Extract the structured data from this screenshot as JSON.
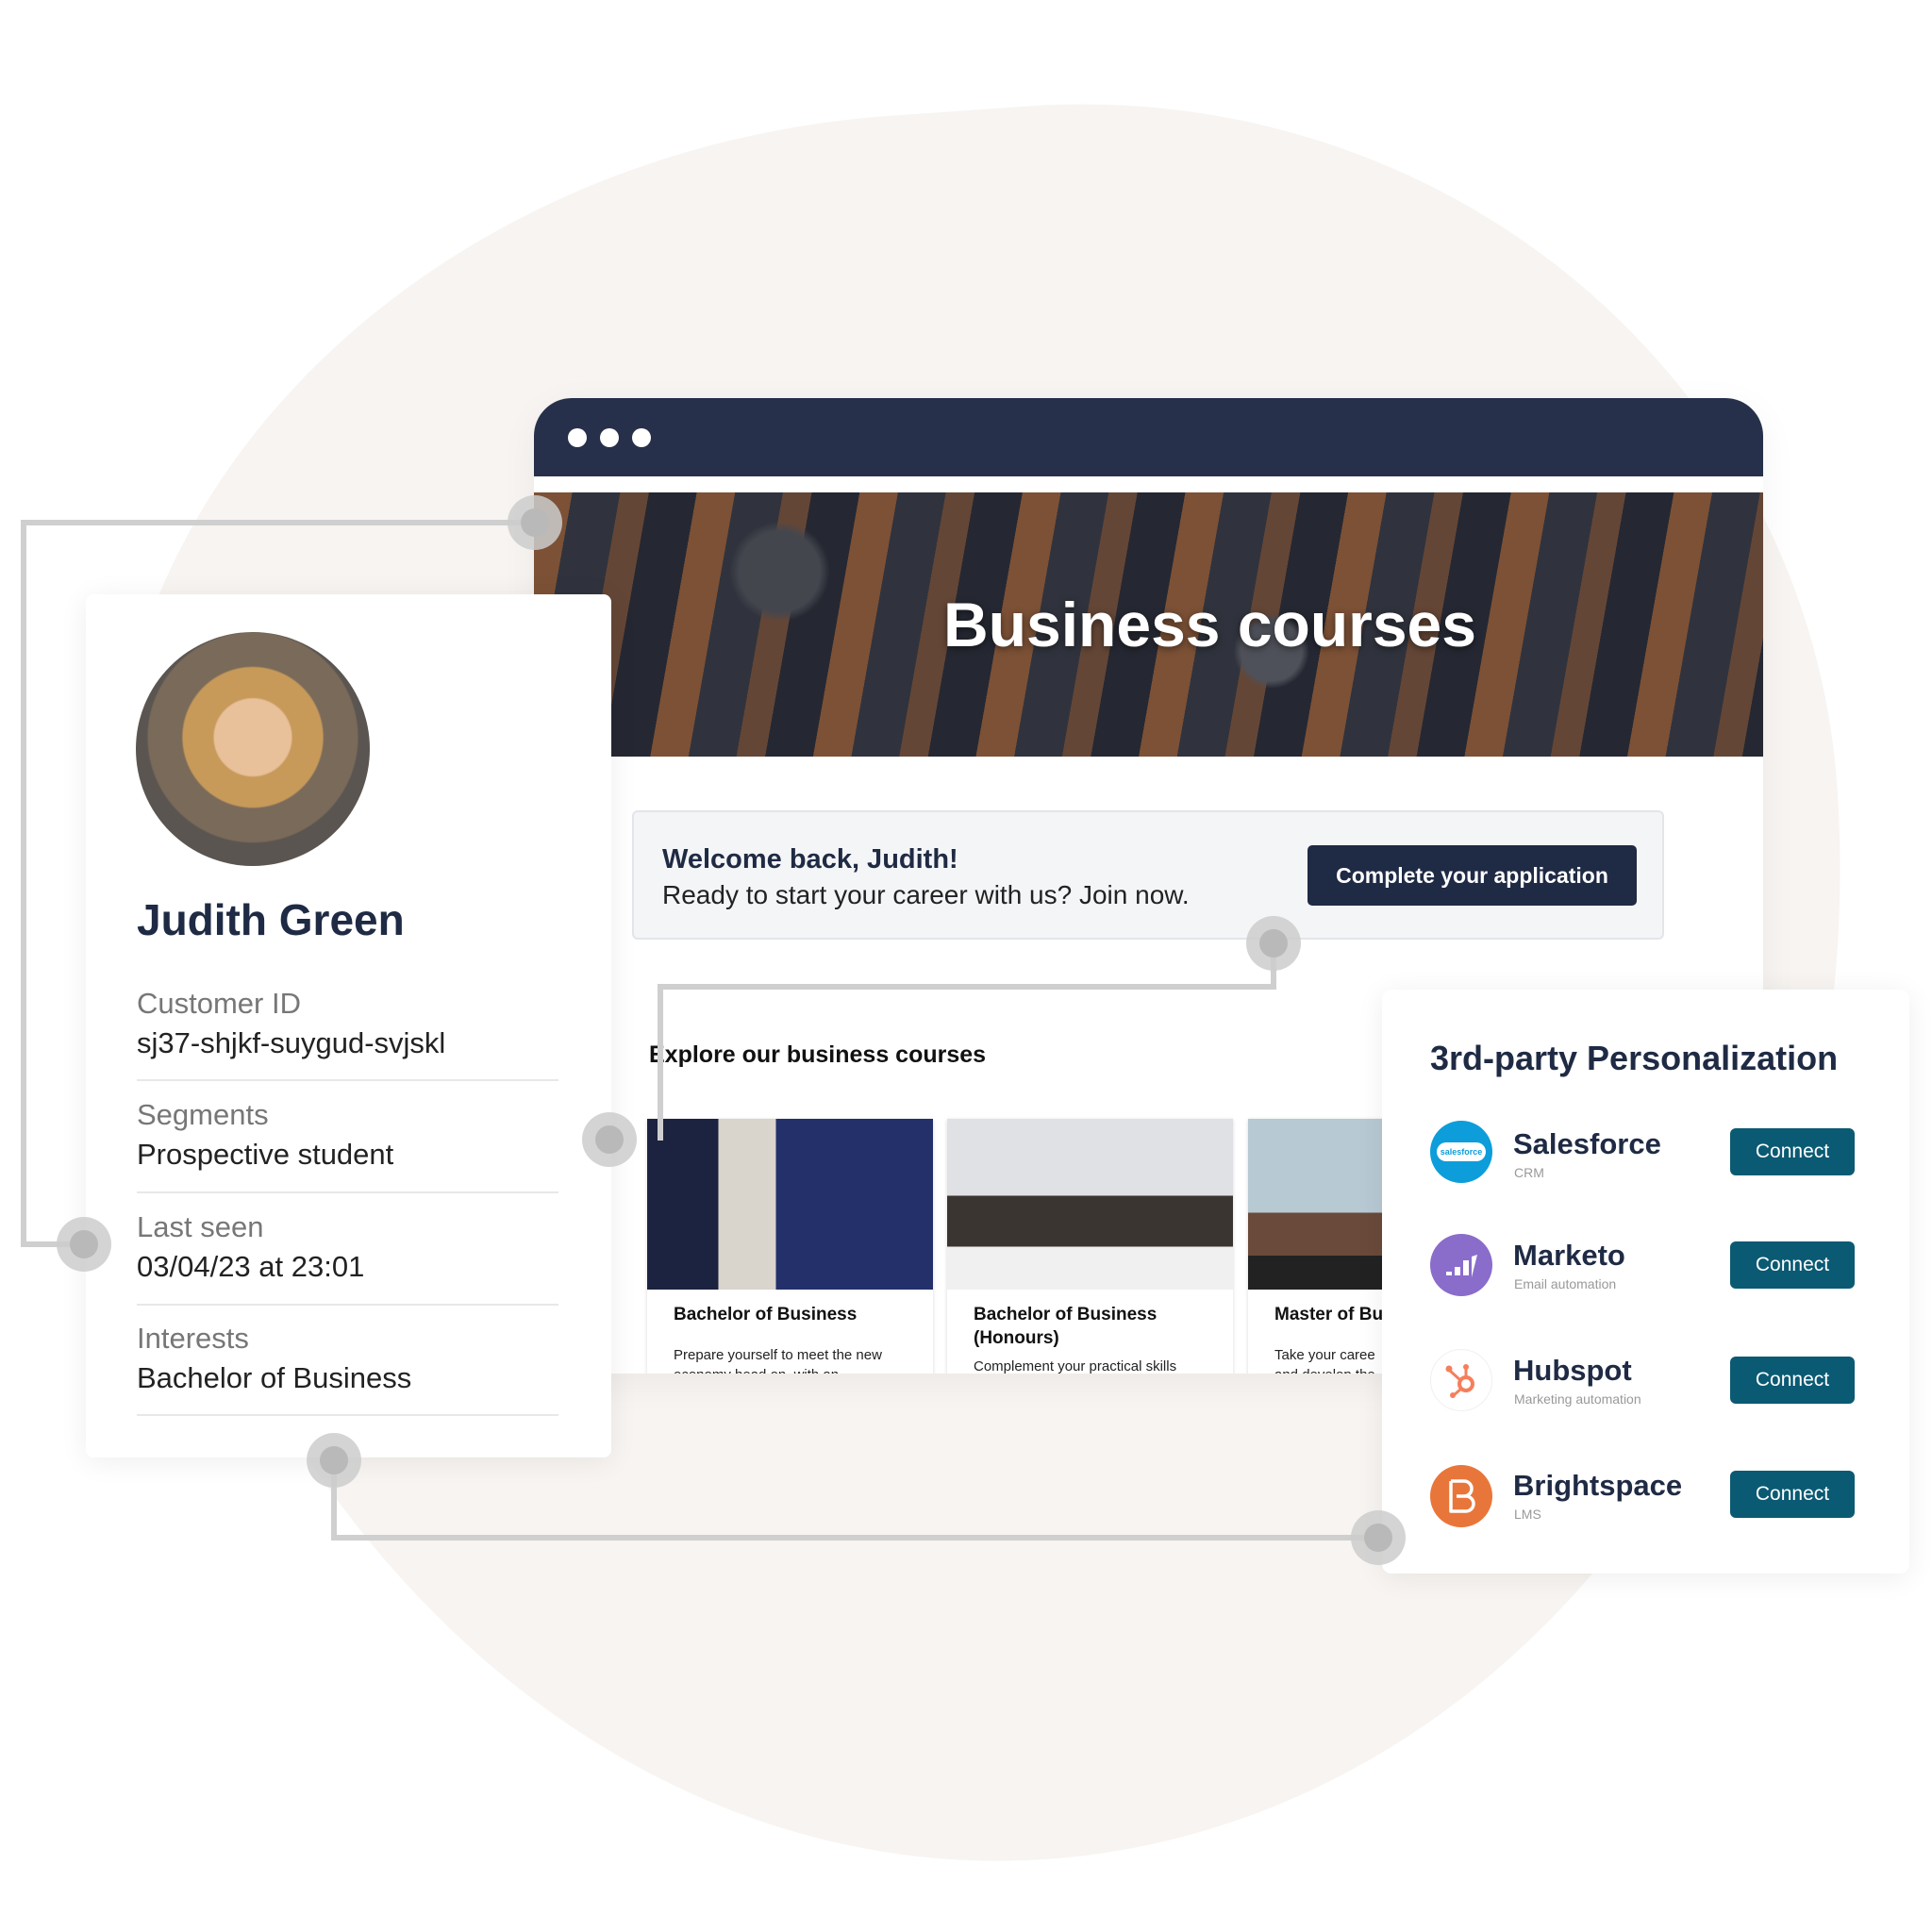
{
  "browser": {
    "hero_title": "Business courses",
    "welcome": {
      "heading": "Welcome back, Judith!",
      "subtext": "Ready to start your career with us? Join now.",
      "cta_label": "Complete your application"
    },
    "explore_heading": "Explore our business courses",
    "courses": [
      {
        "title": "Bachelor of Business",
        "desc": "Prepare yourself to meet the new economy head on, with an"
      },
      {
        "title": "Bachelor of Business (Honours)",
        "desc": "Complement your practical skills"
      },
      {
        "title": "Master of Bu",
        "desc": "Take your caree and develop the"
      }
    ]
  },
  "profile": {
    "name": "Judith Green",
    "fields": [
      {
        "label": "Customer ID",
        "value": "sj37-shjkf-suygud-svjskl"
      },
      {
        "label": "Segments",
        "value": "Prospective student"
      },
      {
        "label": "Last seen",
        "value": "03/04/23 at 23:01"
      },
      {
        "label": "Interests",
        "value": "Bachelor of Business"
      }
    ]
  },
  "integrations": {
    "title": "3rd-party Personalization",
    "connect_label": "Connect",
    "items": [
      {
        "name": "Salesforce",
        "category": "CRM",
        "icon": "salesforce-cloud-icon",
        "logo_text": "salesforce",
        "color": "#0d9dda"
      },
      {
        "name": "Marketo",
        "category": "Email automation",
        "icon": "marketo-bars-icon",
        "color": "#8a6ccb"
      },
      {
        "name": "Hubspot",
        "category": "Marketing automation",
        "icon": "hubspot-sprocket-icon",
        "color": "#f57f5b"
      },
      {
        "name": "Brightspace",
        "category": "LMS",
        "icon": "brightspace-b-icon",
        "color": "#e8763a"
      }
    ]
  },
  "colors": {
    "navy": "#1f2a44",
    "teal_button": "#0b5a73",
    "connector": "#cfcfcf"
  }
}
